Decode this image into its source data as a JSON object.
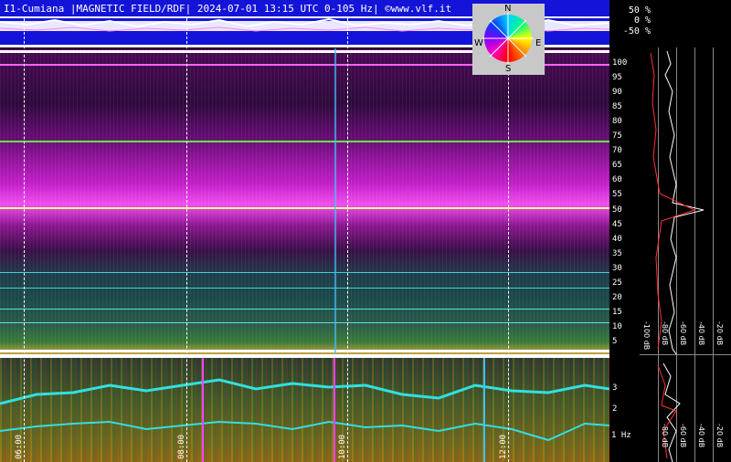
{
  "header": {
    "title": "I1-Cumiana |MAGNETIC FIELD/RDF| 2024-07-01 13:15 UTC 0-105 Hz| ©www.vlf.it"
  },
  "amplitude_scale": [
    "50 %",
    "0 %",
    "-50 %"
  ],
  "compass": {
    "n": "N",
    "e": "E",
    "s": "S",
    "w": "W"
  },
  "frequency_axis": [
    "100",
    "95",
    "90",
    "85",
    "80",
    "75",
    "70",
    "65",
    "60",
    "55",
    "50",
    "45",
    "40",
    "35",
    "30",
    "25",
    "20",
    "15",
    "10",
    "5"
  ],
  "low_freq_axis": [
    "3",
    "2",
    "1 Hz"
  ],
  "time_axis": [
    "06:00",
    "08:00",
    "10:00",
    "12:00"
  ],
  "db_labels_top": [
    "-100 dB",
    "-80 dB",
    "-60 dB",
    "-40 dB",
    "-20 dB"
  ],
  "db_labels_bottom": [
    "-80 dB",
    "-60 dB",
    "-40 dB",
    "-20 dB"
  ],
  "colors": {
    "accent_cyan": "#30e0e0",
    "magenta_band": "#f04ef0",
    "mains_line": "#ffff80",
    "trace_red": "#ff3030",
    "trace_white": "#ffffff"
  }
}
